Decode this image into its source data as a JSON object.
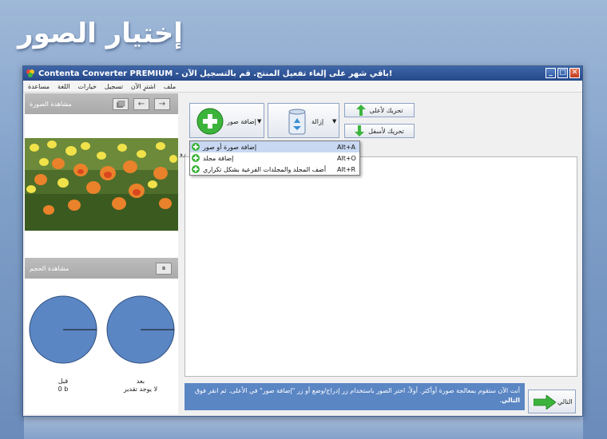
{
  "page_title": "إختيار الصور",
  "window": {
    "title": "Contenta Converter PREMIUM - باقي شهر على إلغاء تفعيل المنتج. قم بالتسجيل الآن!",
    "minimize_glyph": "_",
    "maximize_glyph": "□",
    "close_glyph": "✕"
  },
  "menu": {
    "items": [
      "مساعدة",
      "اللغة",
      "خيارات",
      "تسجيل",
      "اشترِ الآن",
      "ملف"
    ]
  },
  "left_panel": {
    "preview_header": "مشاهدة الصورة",
    "size_header": "مشاهدة الحجم",
    "pause_glyph": "⏸",
    "before_label": "قبل",
    "before_value": "0 b",
    "after_label": "بعد",
    "after_value": "لا يوجد تقدير",
    "nav_prev_glyph": "←",
    "nav_next_glyph": "→"
  },
  "toolbar": {
    "add_images_label": "إضافة صور",
    "remove_label": "إزالة",
    "move_up_label": "تحريك لأعلى",
    "move_down_label": "تحريك لأسفل"
  },
  "dropdown": {
    "items": [
      {
        "label": "إضافة صورة أو صور",
        "shortcut": "Alt+A"
      },
      {
        "label": "إضافة مجلد",
        "shortcut": "Alt+O"
      },
      {
        "label": "أضف المجلد والمجلدات الفرعية بشكل تكراري",
        "shortcut": "Alt+R"
      }
    ]
  },
  "list": {
    "column_hint": "رو"
  },
  "info": {
    "text": "أنت الآن ستقوم بمعالجة صورة أوأكثر. أولاً، اختر الصور باستخدام زر إدراج/وضع أو زر \"إضافة صور\" في الأعلى. ثم انقر فوق",
    "bold_word": "التالي",
    "end": "."
  },
  "next_button": {
    "label": "التالي"
  },
  "colors": {
    "titlebar": "#26498a",
    "info_box": "#5b86c4",
    "pie_fill": "#5b86c4",
    "add_green": "#3cb43c"
  }
}
